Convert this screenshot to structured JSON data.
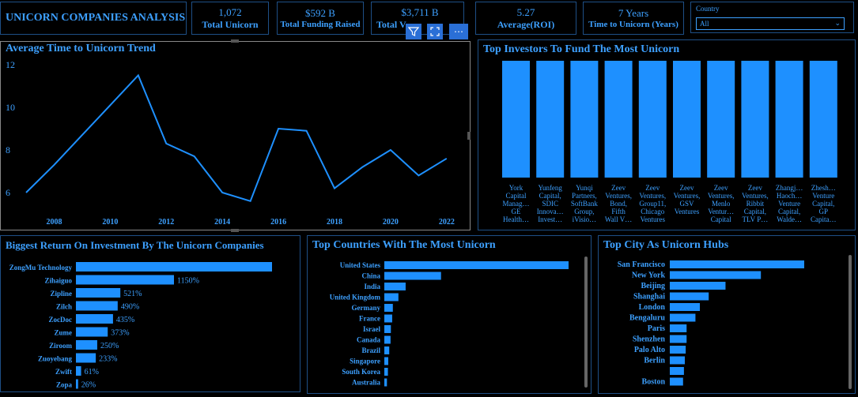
{
  "header": {
    "title": "UNICORN COMPANIES ANALYSIS"
  },
  "kpis": {
    "total_unicorn": {
      "value": "1,072",
      "label": "Total Unicorn"
    },
    "total_funding": {
      "value": "$592 B",
      "label": "Total Funding Raised"
    },
    "total_valuation": {
      "value": "$3,711 B",
      "label": "Total V"
    },
    "avg_roi": {
      "value": "5.27",
      "label": "Average(ROI)"
    },
    "time_to_unicorn": {
      "value": "7 Years",
      "label": "Time to Unicorn (Years)"
    }
  },
  "filter": {
    "label": "Country",
    "selected": "All"
  },
  "toolbar": {
    "filter_icon": "filter-icon",
    "focus_icon": "focus-mode-icon",
    "more": "⋯"
  },
  "trend": {
    "title": "Average Time to Unicorn Trend",
    "chart_data": {
      "type": "line",
      "x": [
        2007,
        2008,
        2009,
        2010,
        2011,
        2012,
        2013,
        2014,
        2015,
        2016,
        2017,
        2018,
        2019,
        2020,
        2021,
        2022
      ],
      "y": [
        6.0,
        7.3,
        8.7,
        10.1,
        11.5,
        8.3,
        7.7,
        6.0,
        5.6,
        9.0,
        8.9,
        6.2,
        7.2,
        8.0,
        6.8,
        7.6
      ],
      "xticks": [
        "2008",
        "2010",
        "2012",
        "2014",
        "2016",
        "2018",
        "2020",
        "2022"
      ],
      "yticks": [
        "6",
        "8",
        "10",
        "12"
      ],
      "ylim": [
        5.5,
        12.2
      ]
    }
  },
  "investors": {
    "title": "Top Investors To Fund The Most Unicorn",
    "chart_data": {
      "type": "bar",
      "categories": [
        [
          "York",
          "Capital",
          "Manag…",
          "GE",
          "Health…"
        ],
        [
          "Yunfeng",
          "Capital,",
          "SDIC",
          "Innova…",
          "Invest…"
        ],
        [
          "Yunqi",
          "Partners,",
          "SoftBank",
          "Group,",
          "iVisio…"
        ],
        [
          "Zeev",
          "Ventures,",
          "Bond,",
          "Fifth",
          "Wall V…"
        ],
        [
          "Zeev",
          "Ventures,",
          "Group11,",
          "Chicago",
          "Ventures"
        ],
        [
          "Zeev",
          "Ventures,",
          "GSV",
          "Ventures"
        ],
        [
          "Zeev",
          "Ventures,",
          "Menlo",
          "Ventur…",
          "Capital"
        ],
        [
          "Zeev",
          "Ventures,",
          "Ribbit",
          "Capital,",
          "TLV P…"
        ],
        [
          "Zhangj…",
          "Haoch…",
          "Venture",
          "Capital,",
          "Walde…"
        ],
        [
          "Zhesh…",
          "Venture",
          "Capital,",
          "GP",
          "Capita…"
        ]
      ],
      "values": [
        1,
        1,
        1,
        1,
        1,
        1,
        1,
        1,
        1,
        1
      ]
    }
  },
  "roi": {
    "title": "Biggest Return On Investment By The Unicorn Companies",
    "chart_data": {
      "type": "bar",
      "categories": [
        "ZongMu Technology",
        "Zihaiguo",
        "Zipline",
        "Zilch",
        "ZocDoc",
        "Zume",
        "Ziroom",
        "Zuoyebang",
        "Zwift",
        "Zopa"
      ],
      "values": [
        2300,
        1150,
        521,
        490,
        435,
        373,
        250,
        233,
        61,
        26
      ],
      "labels": [
        "",
        "1150%",
        "521%",
        "490%",
        "435%",
        "373%",
        "250%",
        "233%",
        "61%",
        "26%"
      ]
    }
  },
  "countries": {
    "title": "Top Countries With The Most Unicorn",
    "chart_data": {
      "type": "bar",
      "categories": [
        "United States",
        "China",
        "India",
        "United Kingdom",
        "Germany",
        "France",
        "Israel",
        "Canada",
        "Brazil",
        "Singapore",
        "South Korea",
        "Australia"
      ],
      "values": [
        562,
        173,
        65,
        43,
        26,
        24,
        20,
        19,
        15,
        12,
        11,
        8
      ]
    }
  },
  "cities": {
    "title": "Top City As Unicorn Hubs",
    "chart_data": {
      "type": "bar",
      "categories": [
        "San Francisco",
        "New York",
        "Beijing",
        "Shanghai",
        "London",
        "Bengaluru",
        "Paris",
        "Shenzhen",
        "Palo Alto",
        "Berlin",
        "",
        "Boston"
      ],
      "values": [
        152,
        103,
        63,
        44,
        34,
        29,
        19,
        19,
        18,
        17,
        16,
        15
      ]
    }
  },
  "colors": {
    "accent": "#1e90ff",
    "border": "#1e4f86",
    "background": "#000000"
  }
}
